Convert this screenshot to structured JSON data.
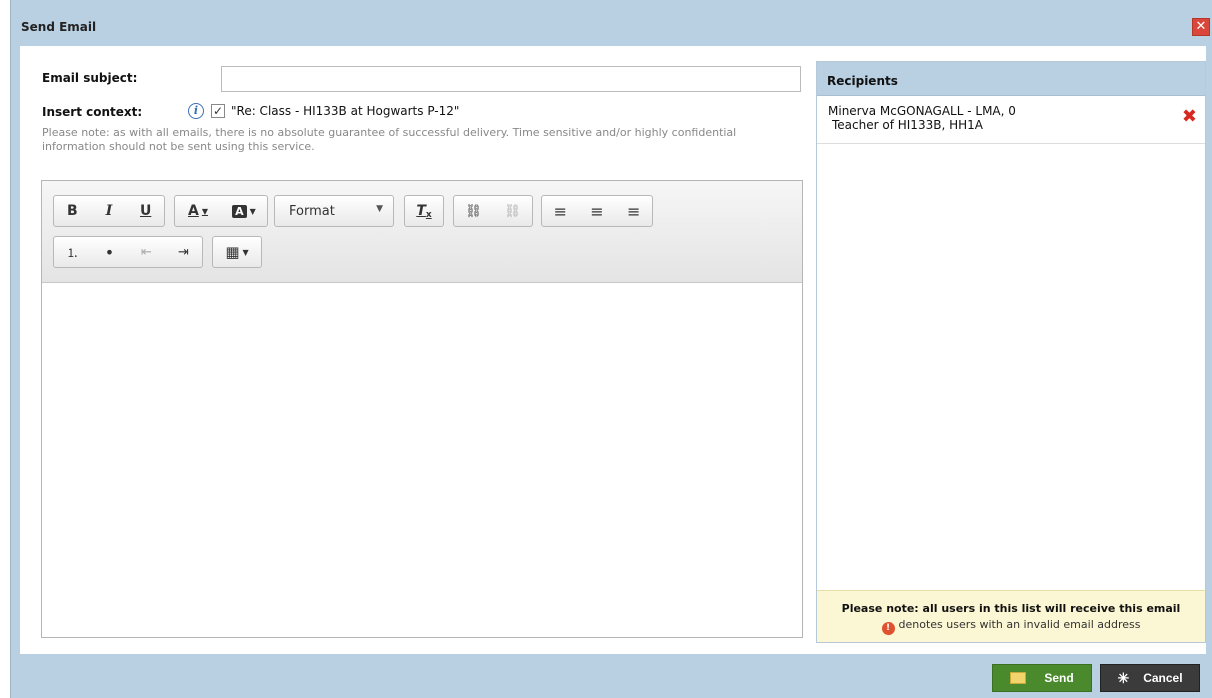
{
  "dialog": {
    "title": "Send Email",
    "close_label": "✕"
  },
  "form": {
    "subject_label": "Email subject:",
    "subject_value": "",
    "context_label": "Insert context:",
    "context_checked": true,
    "context_value": "\"Re: Class - HI133B at Hogwarts P-12\"",
    "note": "Please note: as with all emails, there is no absolute guarantee of successful delivery. Time sensitive and/or highly confidential information should not be sent using this service."
  },
  "toolbar": {
    "bold": "B",
    "italic": "I",
    "underline": "U",
    "text_color": "A",
    "bg_color": "A",
    "format_label": "Format",
    "remove_format": "T",
    "link": "⛓",
    "unlink": "⛓",
    "align_left": "≡",
    "align_center": "≡",
    "align_right": "≡",
    "numbered_list": "⒈",
    "bullet_list": "•",
    "outdent": "⇤",
    "indent": "⇥",
    "table": "▦"
  },
  "recipients": {
    "header": "Recipients",
    "items": [
      {
        "name": "Minerva McGONAGALL - LMA, 0",
        "detail": "Teacher of HI133B, HH1A"
      }
    ],
    "footer_note": "Please note: all users in this list will receive this email",
    "footer_legend": "denotes users with an invalid email address"
  },
  "actions": {
    "send_label": "Send",
    "cancel_label": "Cancel"
  },
  "colors": {
    "header_bg": "#b9d0e2",
    "send_bg": "#4a8a2c",
    "cancel_bg": "#3b3b3b",
    "remove_red": "#d7281f"
  }
}
